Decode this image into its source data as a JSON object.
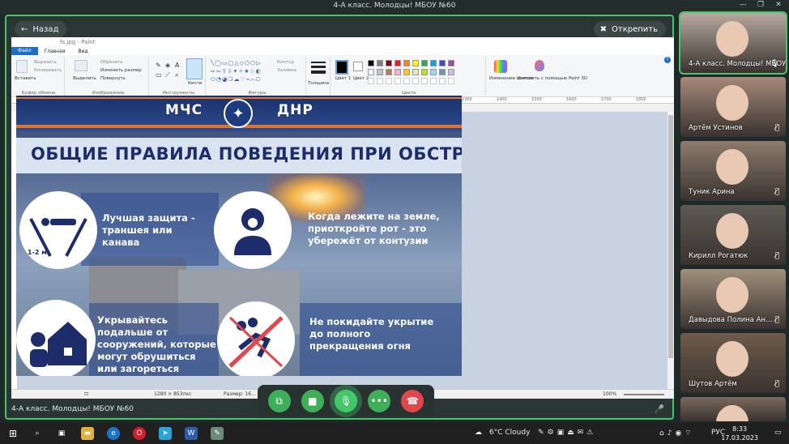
{
  "window": {
    "title": "4-А класс. Молодцы! МБОУ №60"
  },
  "stage": {
    "back_label": "Назад",
    "unpin_label": "Открепить",
    "footer_label": "4-А класс. Молодцы! МБОУ №60"
  },
  "paint": {
    "title": "fs.jpg - Paint",
    "tabs": [
      "Файл",
      "Главная",
      "Вид"
    ],
    "clipboard": {
      "paste": "Вставить",
      "cut": "Вырезать",
      "copy": "Копировать",
      "group": "Буфер обмена"
    },
    "image": {
      "select": "Выделить",
      "crop": "Обрезать",
      "resize": "Изменить размер",
      "rotate": "Повернуть",
      "group": "Изображение"
    },
    "tools": {
      "group": "Инструменты",
      "brushes": "Кисти"
    },
    "shapes": {
      "group": "Фигуры",
      "outline": "Контур",
      "fill": "Заливка"
    },
    "size": "Толщина",
    "color1": "Цвет 1",
    "color2": "Цвет 2",
    "colors_group": "Цвета",
    "edit_colors": "Изменение цветов",
    "paint3d": "Изменить с помощью Paint 3D",
    "ruler_ticks": [
      "100",
      "200",
      "300",
      "400",
      "500",
      "600",
      "700",
      "800",
      "900",
      "1000",
      "1100",
      "1200",
      "1300",
      "1400",
      "1500",
      "1600",
      "1700",
      "1800"
    ],
    "status": {
      "dimensions": "1280 × 853пкс",
      "filesize": "Размер: 16…",
      "zoom": "100%"
    },
    "palette": [
      "#000000",
      "#7f7f7f",
      "#880015",
      "#ed1c24",
      "#ff7f27",
      "#fff200",
      "#22b14c",
      "#00a2e8",
      "#3f48cc",
      "#a349a4",
      "#ffffff",
      "#c3c3c3",
      "#b97a57",
      "#ffaec9",
      "#ffc90e",
      "#efe4b0",
      "#b5e61d",
      "#99d9ea",
      "#7092be",
      "#c8bfe7"
    ]
  },
  "poster": {
    "brand_left": "МЧС",
    "brand_right": "ДНР",
    "headline": "ОБЩИЕ ПРАВИЛА ПОВЕДЕНИЯ ПРИ ОБСТРЕЛЕ",
    "rule1": "Лучшая защита - траншея или канава",
    "rule1_badge": "1-2 м",
    "rule2": "Когда лежите на земле, приоткройте рот - это убережёт от контузии",
    "rule3": "Укрывайтесь подальше от сооружений, которые могут обрушиться или загореться",
    "rule4": "Не покидайте укрытие до полного прекращения огня"
  },
  "participants": [
    {
      "name": "4-А класс. Молодцы! МБОУ №60",
      "muted": false,
      "bg": "#b7a9a0"
    },
    {
      "name": "Артём Устинов",
      "muted": true,
      "bg": "#a6897a"
    },
    {
      "name": "Туник Арина",
      "muted": true,
      "bg": "#8d7b6e"
    },
    {
      "name": "Кирилл Рогатюк",
      "muted": true,
      "bg": "#5c5a53"
    },
    {
      "name": "Давыдова Полина Ан…",
      "muted": true,
      "bg": "#a08f7c"
    },
    {
      "name": "Шутов Артём",
      "muted": true,
      "bg": "#6e5b4b"
    },
    {
      "name": "",
      "muted": false,
      "bg": "#7a6a5e"
    }
  ],
  "taskbar": {
    "weather": "6°C Cloudy",
    "language": "РУС",
    "time": "8:33",
    "date": "17.03.2023"
  }
}
